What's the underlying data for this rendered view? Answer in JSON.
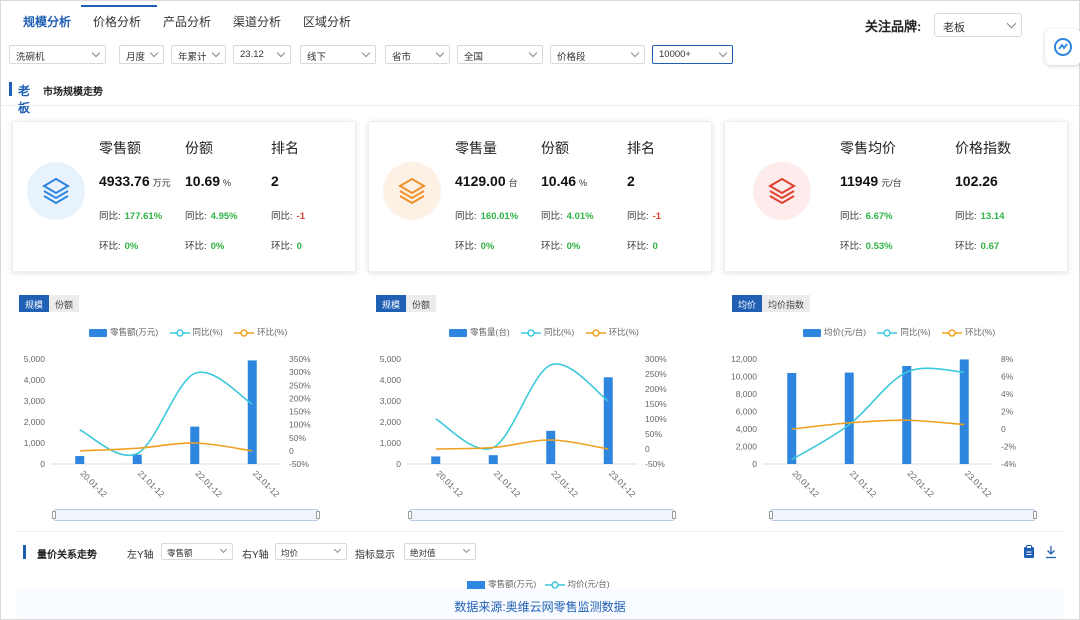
{
  "tabs": [
    {
      "label": "规模分析",
      "active": true
    },
    {
      "label": "价格分析",
      "active": false
    },
    {
      "label": "产品分析",
      "active": false
    },
    {
      "label": "渠道分析",
      "active": false
    },
    {
      "label": "区域分析",
      "active": false
    }
  ],
  "brand": {
    "label": "关注品牌:",
    "value": "老板"
  },
  "filters": {
    "category": "洗碗机",
    "period_type": "月度",
    "accumulate": "年累计",
    "date": "23.12",
    "channel": "线下",
    "region_level": "省市",
    "region": "全国",
    "price_segment": "价格段",
    "price_value": "10000+"
  },
  "section": {
    "brand": "老板",
    "title": "市场规模走势"
  },
  "kpi_cards": [
    {
      "metrics": [
        {
          "label": "零售额",
          "value": "4933.76",
          "unit": "万元",
          "yoy_label": "同比:",
          "yoy": "177.61%",
          "mom_label": "环比:",
          "mom": "0%"
        },
        {
          "label": "份额",
          "value": "10.69",
          "unit": "%",
          "yoy_label": "同比:",
          "yoy": "4.95%",
          "mom_label": "环比:",
          "mom": "0%"
        },
        {
          "label": "排名",
          "value": "2",
          "unit": "",
          "yoy_label": "同比:",
          "yoy": "-1",
          "mom_label": "环比:",
          "mom": "0"
        }
      ],
      "color": "#2e86de",
      "bg": "#e8f2fc"
    },
    {
      "metrics": [
        {
          "label": "零售量",
          "value": "4129.00",
          "unit": "台",
          "yoy_label": "同比:",
          "yoy": "160.01%",
          "mom_label": "环比:",
          "mom": "0%"
        },
        {
          "label": "份额",
          "value": "10.46",
          "unit": "%",
          "yoy_label": "同比:",
          "yoy": "4.01%",
          "mom_label": "环比:",
          "mom": "0%"
        },
        {
          "label": "排名",
          "value": "2",
          "unit": "",
          "yoy_label": "同比:",
          "yoy": "-1",
          "mom_label": "环比:",
          "mom": "0"
        }
      ],
      "color": "#f0922b",
      "bg": "#fdf0e4"
    },
    {
      "metrics": [
        {
          "label": "零售均价",
          "value": "11949",
          "unit": "元/台",
          "yoy_label": "同比:",
          "yoy": "6.67%",
          "mom_label": "环比:",
          "mom": "0.53%"
        },
        {
          "label": "价格指数",
          "value": "102.26",
          "unit": "",
          "yoy_label": "同比:",
          "yoy": "13.14",
          "mom_label": "环比:",
          "mom": "0.67"
        }
      ],
      "color": "#e0402f",
      "bg": "#fdeceb"
    }
  ],
  "colors": {
    "bar": "#2e86de",
    "yoy": "#3cc9dc",
    "mom": "#f0a020",
    "accent": "#1f5fb4",
    "up": "#2fb344",
    "down": "#e0402f"
  },
  "chart_data": [
    {
      "type": "bar",
      "toggles": [
        "规模",
        "份额"
      ],
      "categories": [
        "20.01-12",
        "21.01-12",
        "22.01-12",
        "23.01-12"
      ],
      "series": [
        {
          "name": "零售额(万元)",
          "type": "bar",
          "axis": "left",
          "values": [
            380,
            450,
            1780,
            4934
          ]
        },
        {
          "name": "同比(%)",
          "type": "line",
          "axis": "right",
          "values": [
            80,
            -10,
            295,
            178
          ]
        },
        {
          "name": "环比(%)",
          "type": "line",
          "axis": "right",
          "values": [
            0,
            10,
            30,
            0
          ]
        }
      ],
      "left_ticks": [
        "0",
        "1,000",
        "2,000",
        "3,000",
        "4,000",
        "5,000"
      ],
      "right_ticks": [
        "-50%",
        "0",
        "50%",
        "100%",
        "150%",
        "200%",
        "250%",
        "300%",
        "350%"
      ],
      "ylim": [
        0,
        5000
      ],
      "y2lim": [
        -50,
        350
      ]
    },
    {
      "type": "bar",
      "toggles": [
        "规模",
        "份额"
      ],
      "categories": [
        "20.01-12",
        "21.01-12",
        "22.01-12",
        "23.01-12"
      ],
      "series": [
        {
          "name": "零售量(台)",
          "type": "bar",
          "axis": "left",
          "values": [
            360,
            420,
            1580,
            4129
          ]
        },
        {
          "name": "同比(%)",
          "type": "line",
          "axis": "right",
          "values": [
            100,
            5,
            280,
            160
          ]
        },
        {
          "name": "环比(%)",
          "type": "line",
          "axis": "right",
          "values": [
            0,
            5,
            30,
            0
          ]
        }
      ],
      "left_ticks": [
        "0",
        "1,000",
        "2,000",
        "3,000",
        "4,000",
        "5,000"
      ],
      "right_ticks": [
        "-50%",
        "0",
        "50%",
        "100%",
        "150%",
        "200%",
        "250%",
        "300%"
      ],
      "ylim": [
        0,
        5000
      ],
      "y2lim": [
        -50,
        300
      ]
    },
    {
      "type": "bar",
      "toggles": [
        "均价",
        "均价指数"
      ],
      "categories": [
        "20.01-12",
        "21.01-12",
        "22.01-12",
        "23.01-12"
      ],
      "series": [
        {
          "name": "均价(元/台)",
          "type": "bar",
          "axis": "left",
          "values": [
            10400,
            10450,
            11200,
            11949
          ]
        },
        {
          "name": "同比(%)",
          "type": "line",
          "axis": "right",
          "values": [
            -3.5,
            0.5,
            6.5,
            6.5
          ]
        },
        {
          "name": "环比(%)",
          "type": "line",
          "axis": "right",
          "values": [
            0,
            0.7,
            1.0,
            0.5
          ]
        }
      ],
      "left_ticks": [
        "0",
        "2,000",
        "4,000",
        "6,000",
        "8,000",
        "10,000",
        "12,000"
      ],
      "right_ticks": [
        "-4%",
        "-2%",
        "0",
        "2%",
        "4%",
        "6%",
        "8%"
      ],
      "ylim": [
        0,
        12000
      ],
      "y2lim": [
        -4,
        8
      ]
    }
  ],
  "bottom": {
    "title": "量价关系走势",
    "left_axis_label": "左Y轴",
    "left_axis_value": "零售额",
    "right_axis_label": "右Y轴",
    "right_axis_value": "均价",
    "metric_label": "指标显示",
    "metric_value": "绝对值",
    "legend": [
      "零售额(万元)",
      "均价(元/台)"
    ]
  },
  "footer": {
    "source": "数据来源:奥维云网零售监测数据"
  }
}
